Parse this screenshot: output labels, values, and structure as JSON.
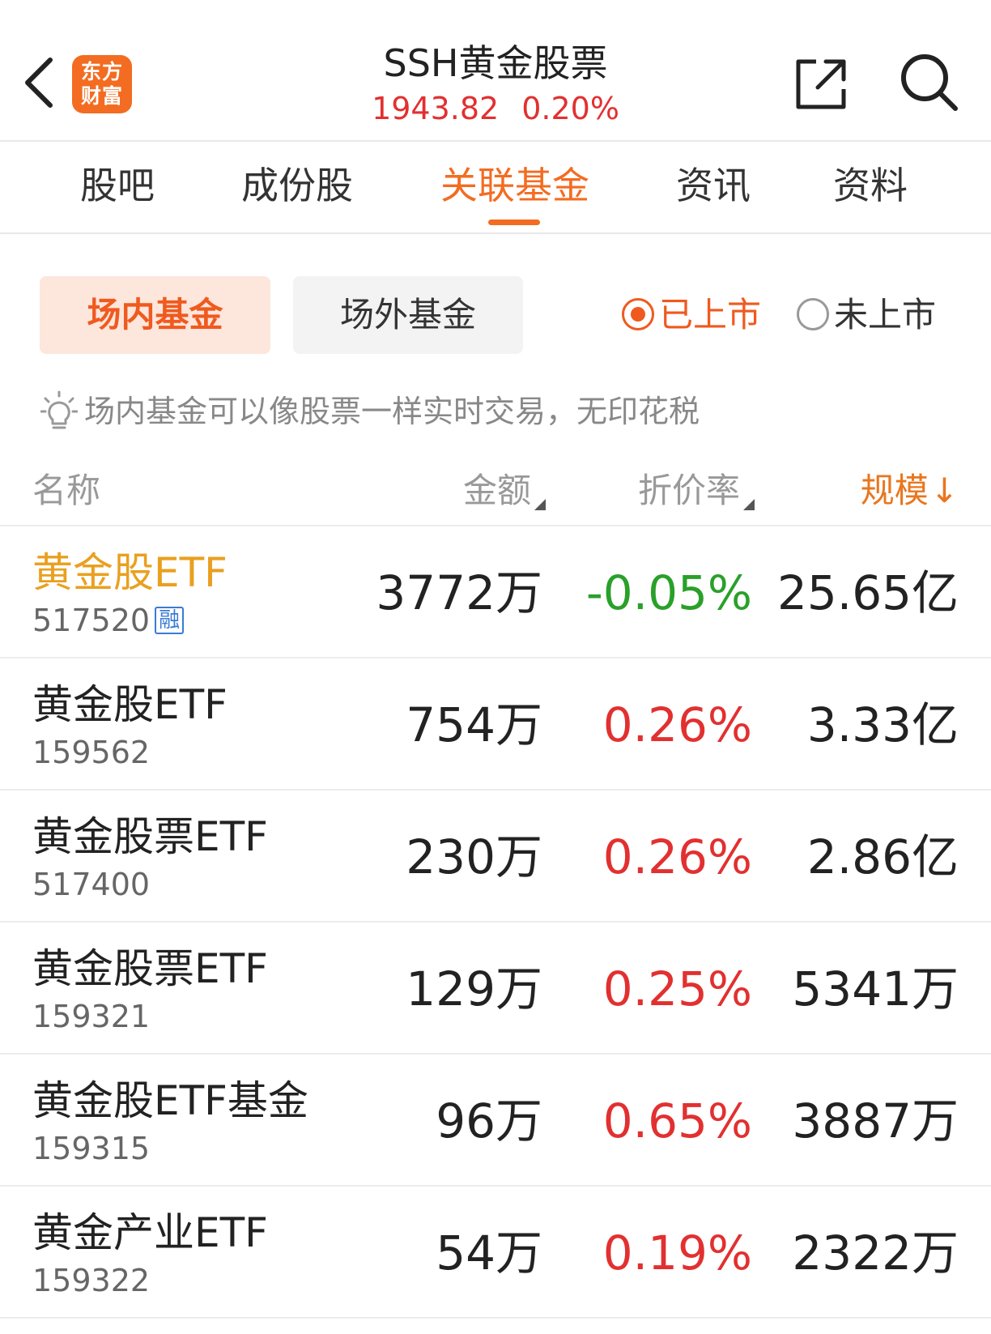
{
  "header": {
    "logo_line1": "东方",
    "logo_line2": "财富",
    "title": "SSH黄金股票",
    "price": "1943.82",
    "change_pct": "0.20%",
    "accent_color": "#f36c21",
    "up_color": "#e23030",
    "down_color": "#2aa02a"
  },
  "tabs": [
    {
      "label": "股吧"
    },
    {
      "label": "成份股"
    },
    {
      "label": "关联基金",
      "active": true
    },
    {
      "label": "资讯"
    },
    {
      "label": "资料"
    }
  ],
  "filters": {
    "segment_in": "场内基金",
    "segment_out": "场外基金",
    "radio_listed": "已上市",
    "radio_unlisted": "未上市",
    "hint": "场内基金可以像股票一样实时交易，无印花税"
  },
  "table": {
    "headers": {
      "name": "名称",
      "amount": "金额",
      "discount": "折价率",
      "scale": "规模",
      "scale_sort": "↓"
    },
    "rows": [
      {
        "name": "黄金股ETF",
        "code": "517520",
        "badge": "融",
        "amount": "3772万",
        "discount": "-0.05%",
        "scale": "25.65亿"
      },
      {
        "name": "黄金股ETF",
        "code": "159562",
        "amount": "754万",
        "discount": "0.26%",
        "scale": "3.33亿"
      },
      {
        "name": "黄金股票ETF",
        "code": "517400",
        "amount": "230万",
        "discount": "0.26%",
        "scale": "2.86亿"
      },
      {
        "name": "黄金股票ETF",
        "code": "159321",
        "amount": "129万",
        "discount": "0.25%",
        "scale": "5341万"
      },
      {
        "name": "黄金股ETF基金",
        "code": "159315",
        "amount": "96万",
        "discount": "0.65%",
        "scale": "3887万"
      },
      {
        "name": "黄金产业ETF",
        "code": "159322",
        "amount": "54万",
        "discount": "0.19%",
        "scale": "2322万"
      }
    ]
  }
}
